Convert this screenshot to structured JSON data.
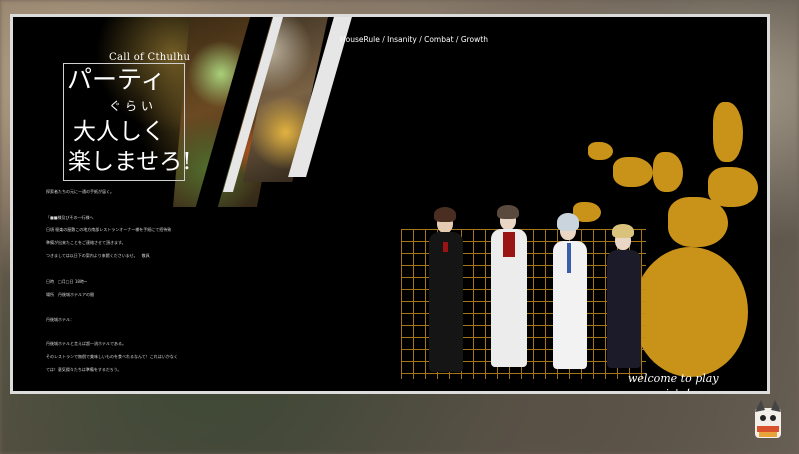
{
  "header": {
    "game": "Call of Cthulhu",
    "title_line1": "パーティ",
    "title_line2": "ぐらい",
    "title_line3": "大人しく",
    "title_line4": "楽しませろ!",
    "tags": "HouseRule / Insanity / Combat / Growth"
  },
  "intro": {
    "p1": "探索者たちの元に一通の手紙が届く。",
    "p2": "「■■様及びその一行様へ",
    "p3": "日頃 極楽の屋敷この地方南部レストランオーナー様を手紙にて招待致",
    "p4": "準備が出来たことをご連絡させて頂きます。",
    "p5": "つきましては以日下の案内より来館くださいませ。　敬具",
    "date": "日時　□月□日 18時~",
    "place": "場所　丹後城ホテルアの間",
    "hotel": "丹後城ホテル：",
    "d1": "丹後城ホテルと言えば超一流ホテルである。",
    "d2": "そのレストランで無償で美味しいものを食べれるなんて！これはいかなく",
    "d3": "ては！意気揚々たちは準備をするだろう。"
  },
  "art": {
    "welcome": "welcome to play scenario's！"
  },
  "colors": {
    "frame_bg": "#000000",
    "gold": "#c99219",
    "border": "#dcdcdc"
  }
}
